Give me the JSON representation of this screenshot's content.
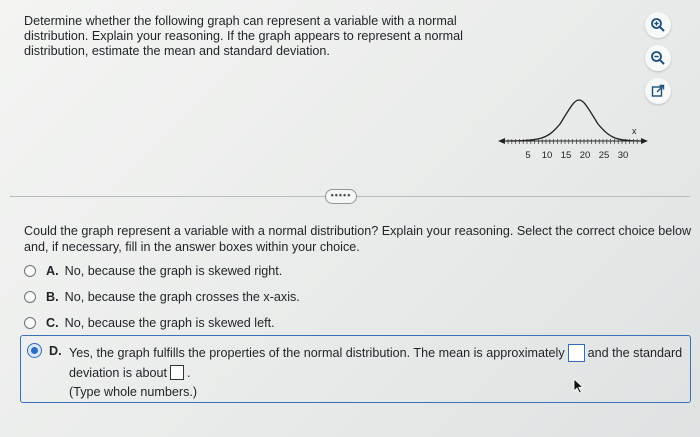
{
  "question": {
    "lines": [
      "Determine whether the following graph can represent a variable with a normal",
      "distribution. Explain your reasoning. If the graph appears to represent a normal",
      "distribution, estimate the mean and standard deviation."
    ]
  },
  "tools": {
    "zoom_in_icon": "zoom-in-icon",
    "zoom_out_icon": "zoom-out-icon",
    "popout_icon": "external-link-icon"
  },
  "graph": {
    "axis_label": "x",
    "ticks": [
      "5",
      "10",
      "15",
      "20",
      "25",
      "30"
    ]
  },
  "more_button": "•••••",
  "prompt": {
    "lines": [
      "Could the graph represent a variable with a normal distribution? Explain your reasoning. Select the correct choice below",
      "and, if necessary, fill in the answer boxes within your choice."
    ]
  },
  "choices": {
    "a": {
      "letter": "A.",
      "text": "No, because the graph is skewed right."
    },
    "b": {
      "letter": "B.",
      "text": "No, because the graph crosses the x-axis."
    },
    "c": {
      "letter": "C.",
      "text": "No, because the graph is skewed left."
    },
    "d": {
      "letter": "D.",
      "text_1": "Yes, the graph fulfills the properties of the normal distribution. The mean is approximately",
      "text_2": "and the standard",
      "text_3": "deviation is about",
      "text_4": ".",
      "hint": "(Type whole numbers.)",
      "mean_value": "",
      "sd_value": ""
    }
  },
  "colors": {
    "accent": "#2f6cc2"
  }
}
